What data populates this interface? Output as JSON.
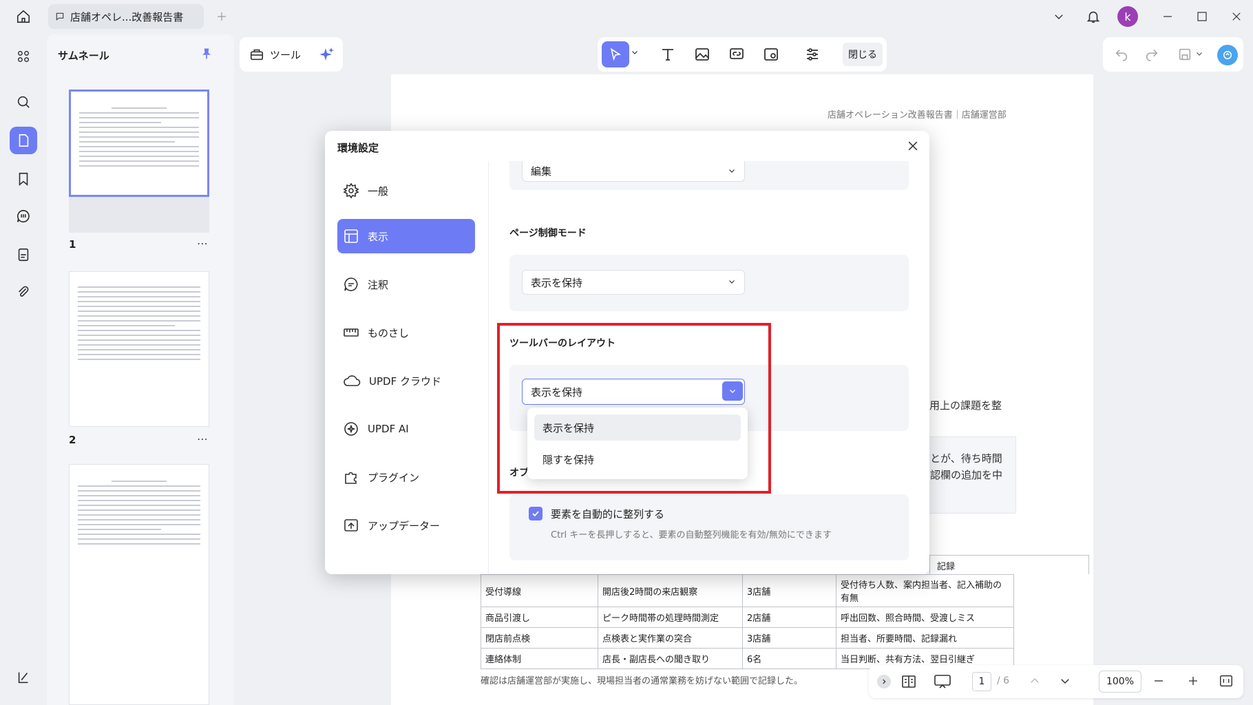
{
  "titlebar": {
    "tab_title": "店舗オペレ...改善報告書",
    "avatar_letter": "k"
  },
  "sidebar": {
    "panel_title": "サムネール",
    "pages": [
      "1",
      "2"
    ]
  },
  "toolbar": {
    "tools_label": "ツール",
    "close_label": "閉じる"
  },
  "document": {
    "header": "店舗オペレーション改善報告書｜店舗運営部",
    "para_fragment": "用上の課題を整",
    "box_line1": "とが、待ち時間",
    "box_line2": "認欄の追加を中",
    "table_header_last": "記録",
    "rows": [
      [
        "受付導線",
        "開店後2時間の来店観察",
        "3店舗",
        "受付待ち人数、案内担当者、記入補助の有無"
      ],
      [
        "商品引渡し",
        "ピーク時間帯の処理時間測定",
        "2店舗",
        "呼出回数、照合時間、受渡しミス"
      ],
      [
        "閉店前点検",
        "点検表と実作業の突合",
        "3店舗",
        "担当者、所要時間、記録漏れ"
      ],
      [
        "連絡体制",
        "店長・副店長への聞き取り",
        "6名",
        "当日判断、共有方法、翌日引継ぎ"
      ]
    ],
    "footer": "確認は店舗運営部が実施し、現場担当者の通常業務を妨げない範囲で記録した。"
  },
  "bottombar": {
    "page_current": "1",
    "page_total": "/ 6",
    "zoom": "100%"
  },
  "dialog": {
    "title": "環境設定",
    "nav": {
      "general": "一般",
      "display": "表示",
      "annotation": "注釈",
      "ruler": "ものさし",
      "cloud": "UPDF クラウド",
      "ai": "UPDF AI",
      "plugin": "プラグイン",
      "updater": "アップデーター"
    },
    "top_select": "編集",
    "page_control_title": "ページ制御モード",
    "page_control_value": "表示を保持",
    "toolbar_layout_title": "ツールバーのレイアウト",
    "toolbar_layout_value": "表示を保持",
    "options_title_fragment": "オプ",
    "dropdown_options": [
      "表示を保持",
      "隠すを保持"
    ],
    "checkbox_label": "要素を自動的に整列する",
    "checkbox_hint": "Ctrl キーを長押しすると、要素の自動整列機能を有効/無効にできます"
  },
  "colors": {
    "accent": "#6d7cf5",
    "highlight_red": "#e0202a"
  }
}
